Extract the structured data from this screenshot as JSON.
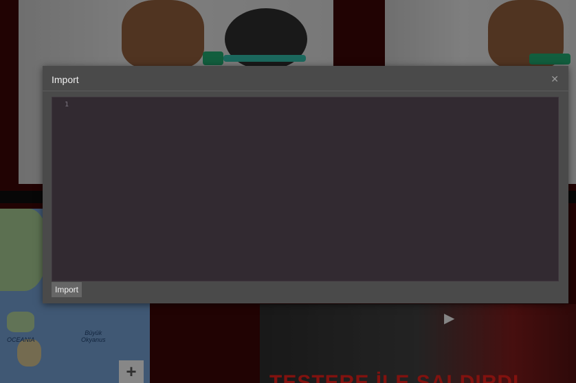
{
  "modal": {
    "title": "Import",
    "close_icon": "close-icon",
    "import_button": "Import",
    "editor": {
      "line_numbers": [
        "1"
      ],
      "content": ""
    }
  },
  "background": {
    "map": {
      "label_oceania": "OCEANIA",
      "label_ocean": "Büyük\nOkyanus",
      "zoom_in": "+"
    },
    "video": {
      "play_icon": "play-icon",
      "headline": "TESTERE İLE SALDIRDI"
    }
  },
  "colors": {
    "modal_bg": "#4a4a4a",
    "editor_bg": "#322a31",
    "page_bg": "#3a0606"
  }
}
